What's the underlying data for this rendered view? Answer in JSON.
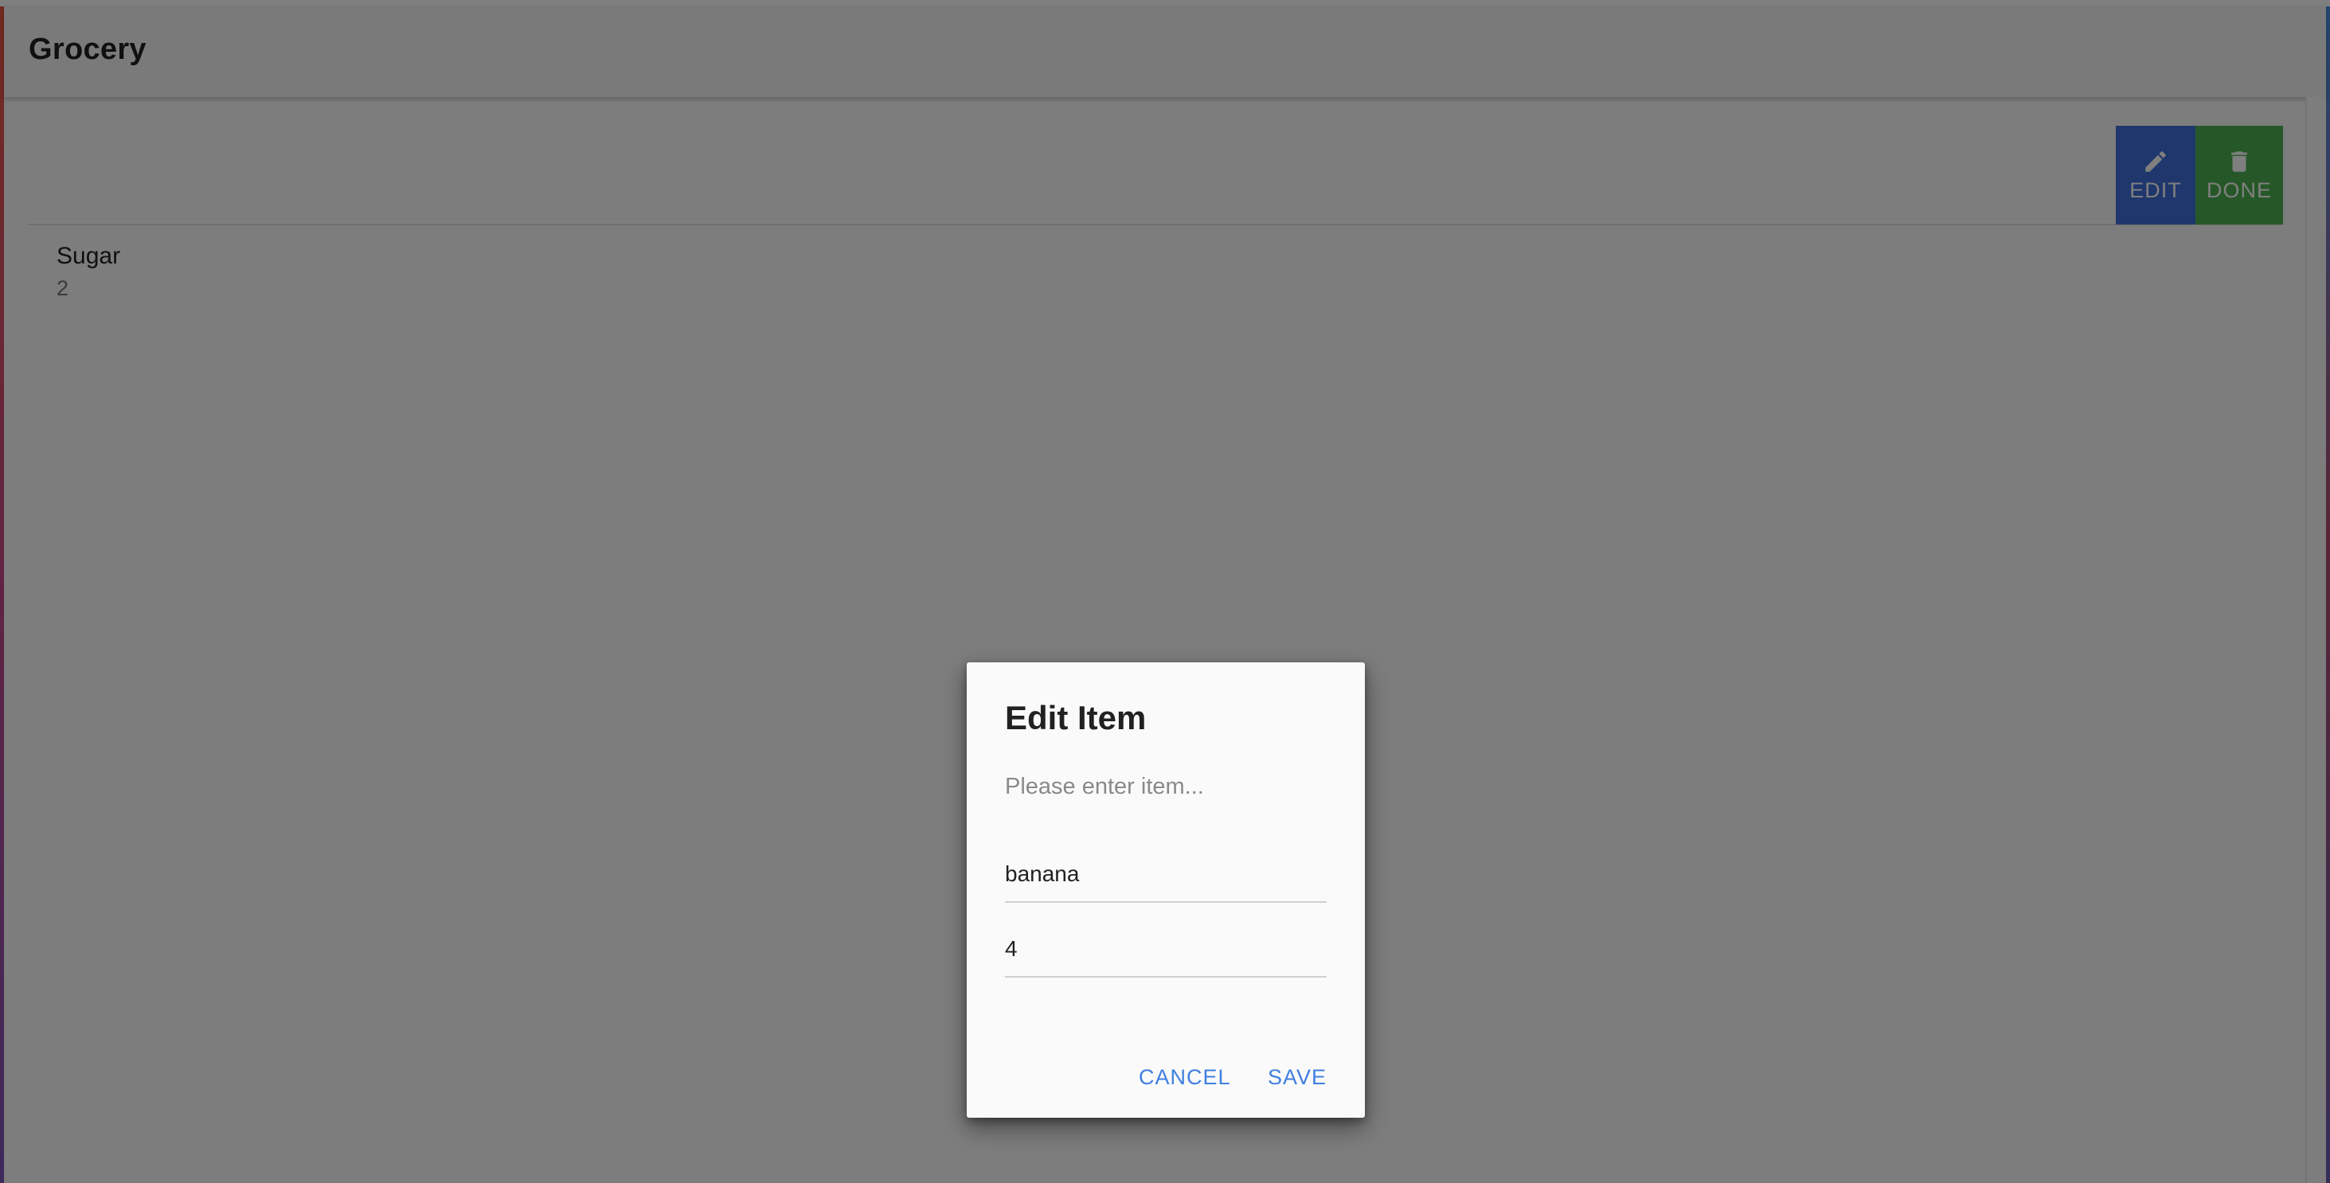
{
  "app": {
    "title": "Grocery"
  },
  "toolbar": {
    "edit_label": "EDIT",
    "edit_icon": "pencil-icon",
    "done_label": "DONE",
    "done_icon": "trash-icon",
    "edit_color": "#3f6fd8",
    "done_color": "#4caf50"
  },
  "list": {
    "items": [
      {
        "name": "Sugar",
        "quantity": "2"
      }
    ]
  },
  "dialog": {
    "title": "Edit Item",
    "item_placeholder": "Please enter item...",
    "name_value": "banana",
    "quantity_value": "4",
    "cancel_label": "CANCEL",
    "save_label": "SAVE",
    "accent_color": "#3f7fe0"
  }
}
